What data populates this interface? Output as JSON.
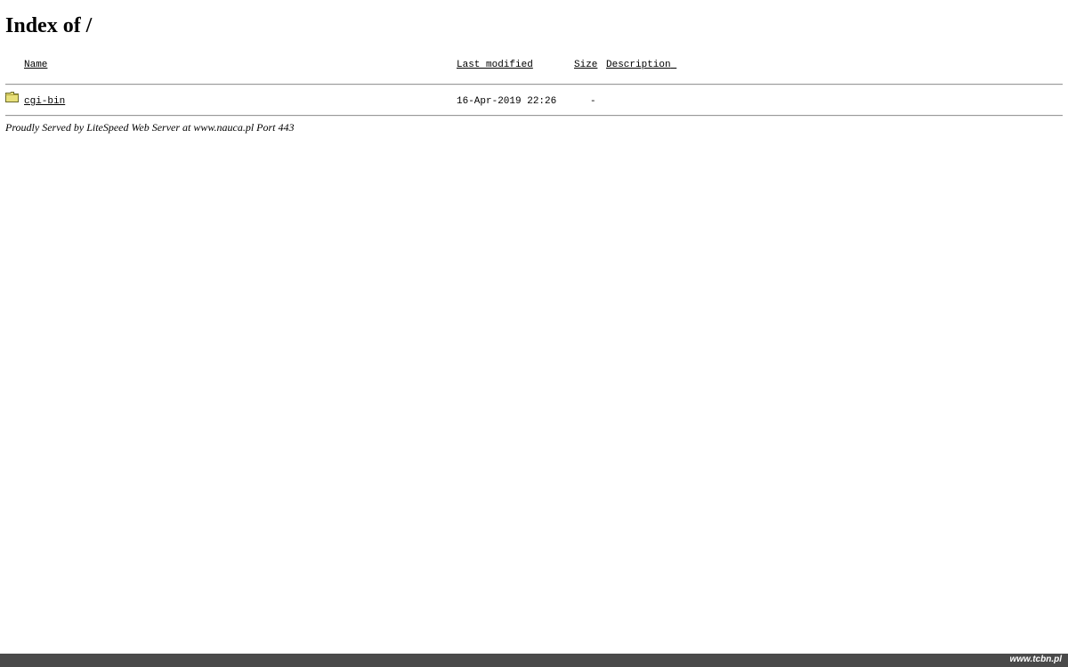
{
  "page": {
    "title": "Index of /"
  },
  "table": {
    "headers": {
      "name": "Name",
      "last_modified": "Last modified",
      "size": "Size",
      "description": "Description"
    },
    "rows": [
      {
        "icon": "folder-icon",
        "name": "cgi-bin",
        "last_modified": "16-Apr-2019 22:26",
        "size": "-",
        "description": ""
      }
    ]
  },
  "footer": {
    "text": "Proudly Served by LiteSpeed Web Server at www.nauca.pl Port 443"
  },
  "bottom_bar": {
    "watermark": "www.tcbn.pl"
  },
  "colors": {
    "link": "#0000ee",
    "folder": "#e8e07a",
    "bottom_bar": "#4a4a4a"
  }
}
